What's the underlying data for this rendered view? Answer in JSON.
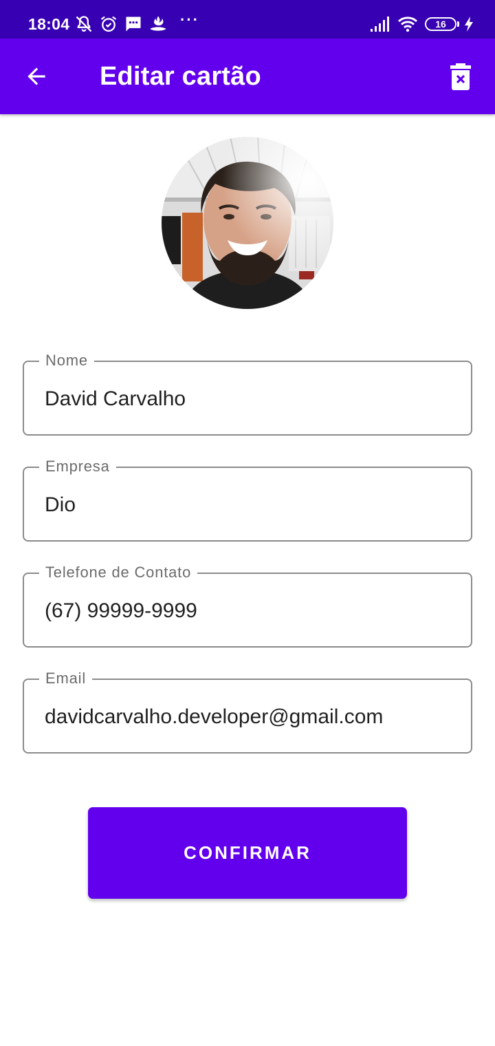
{
  "status_bar": {
    "time": "18:04",
    "icons_left": [
      "mute-bell-icon",
      "alarm-icon",
      "message-icon",
      "santander-flame-icon"
    ],
    "more": "···",
    "icons_right": [
      "signal-icon",
      "wifi-icon",
      "battery-icon",
      "charging-icon"
    ],
    "battery_level": "16"
  },
  "app_bar": {
    "title": "Editar cartão",
    "back_icon": "arrow-back-icon",
    "delete_icon": "delete-icon",
    "background": "#6200EE"
  },
  "avatar": {
    "icon": "profile-photo"
  },
  "form": {
    "fields": [
      {
        "label": "Nome",
        "value": "David Carvalho"
      },
      {
        "label": "Empresa",
        "value": "Dio"
      },
      {
        "label": "Telefone de Contato",
        "value": "(67) 99999-9999"
      },
      {
        "label": "Email",
        "value": "davidcarvalho.developer@gmail.com"
      }
    ]
  },
  "confirm_button": {
    "label": "CONFIRMAR"
  },
  "colors": {
    "primary": "#6200EE",
    "primary_dark": "#3700B3",
    "outline": "#8a8a8a",
    "label": "#6b6b6b"
  }
}
